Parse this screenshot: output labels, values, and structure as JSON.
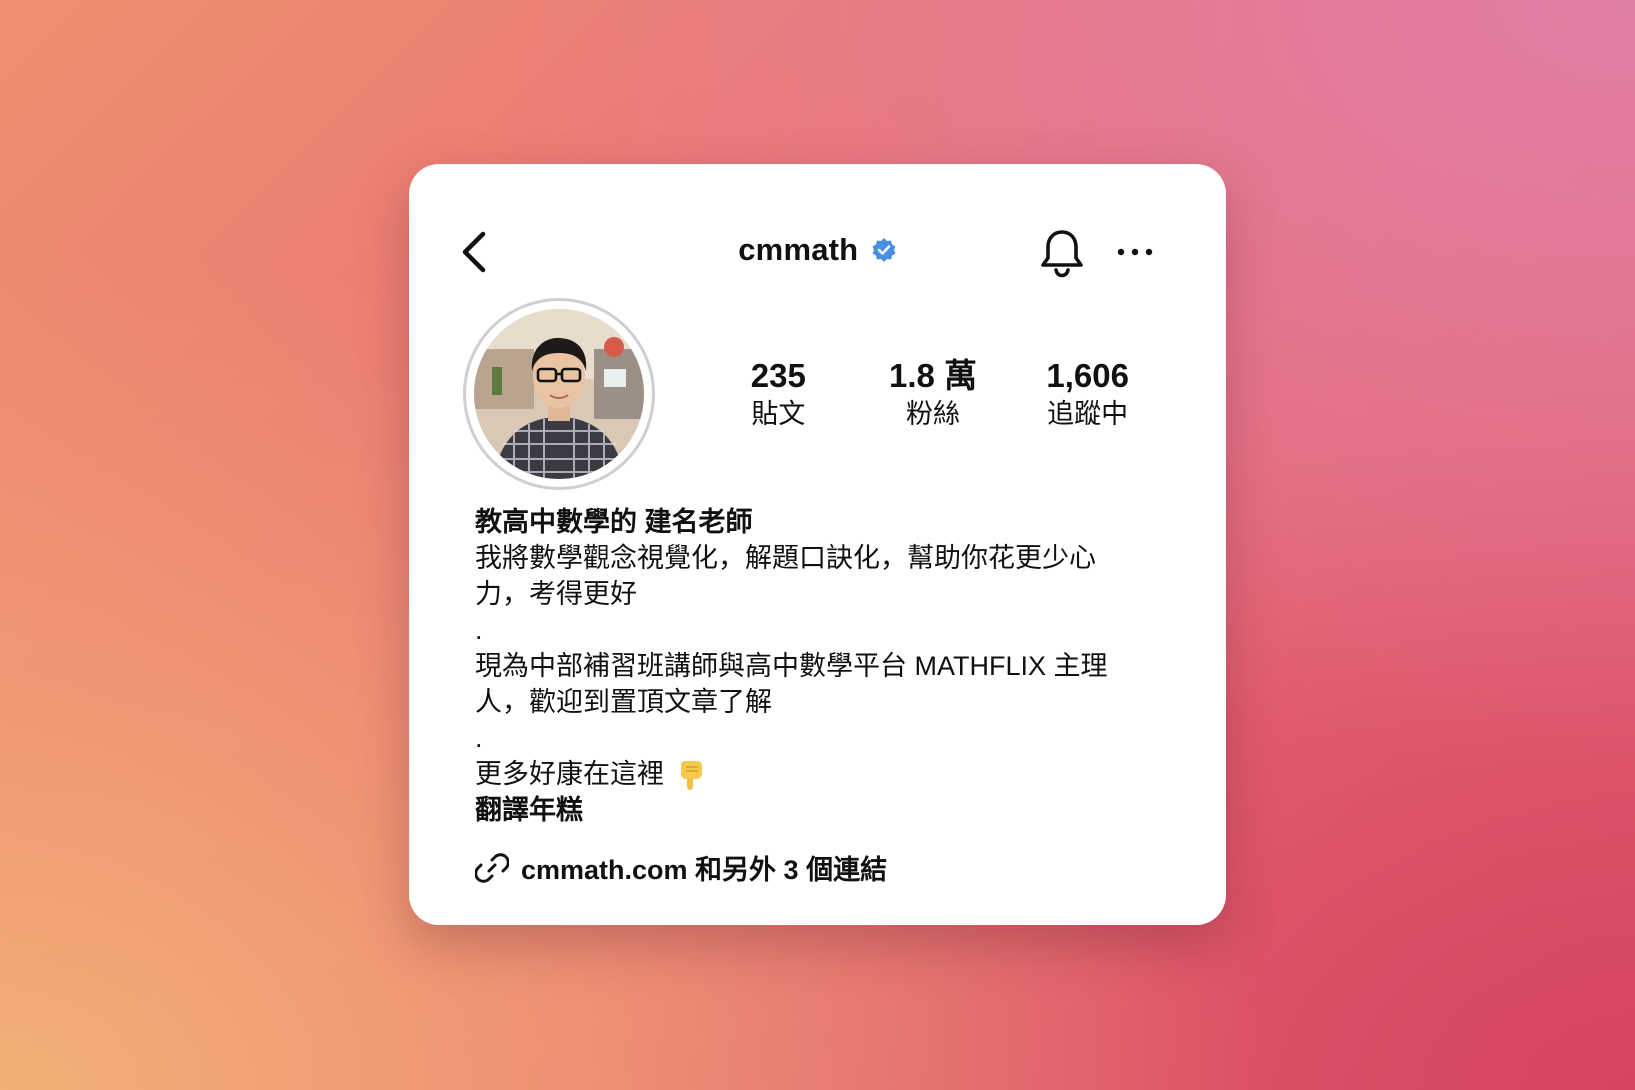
{
  "header": {
    "username": "cmmath",
    "verified": true
  },
  "stats": [
    {
      "value": "235",
      "label": "貼文"
    },
    {
      "value": "1.8 萬",
      "label": "粉絲"
    },
    {
      "value": "1,606",
      "label": "追蹤中"
    }
  ],
  "bio": {
    "name": "教高中數學的 建名老師",
    "line1": "我將數學觀念視覺化，解題口訣化，幫助你花更少心",
    "line2": "力，考得更好",
    "sep1": ".",
    "line3": "現為中部補習班講師與高中數學平台 MATHFLIX 主理",
    "line4": "人，歡迎到置頂文章了解",
    "sep2": ".",
    "line5": "更多好康在這裡",
    "highlight": "翻譯年糕"
  },
  "links": {
    "text": "cmmath.com 和另外 3 個連結"
  },
  "icons": [
    "back-chevron-icon",
    "verified-badge-icon",
    "bell-icon",
    "more-icon",
    "hand-pointing-down-icon",
    "link-icon"
  ],
  "colors": {
    "verified": "#4a90e2",
    "text": "#111111",
    "card": "#ffffff"
  }
}
